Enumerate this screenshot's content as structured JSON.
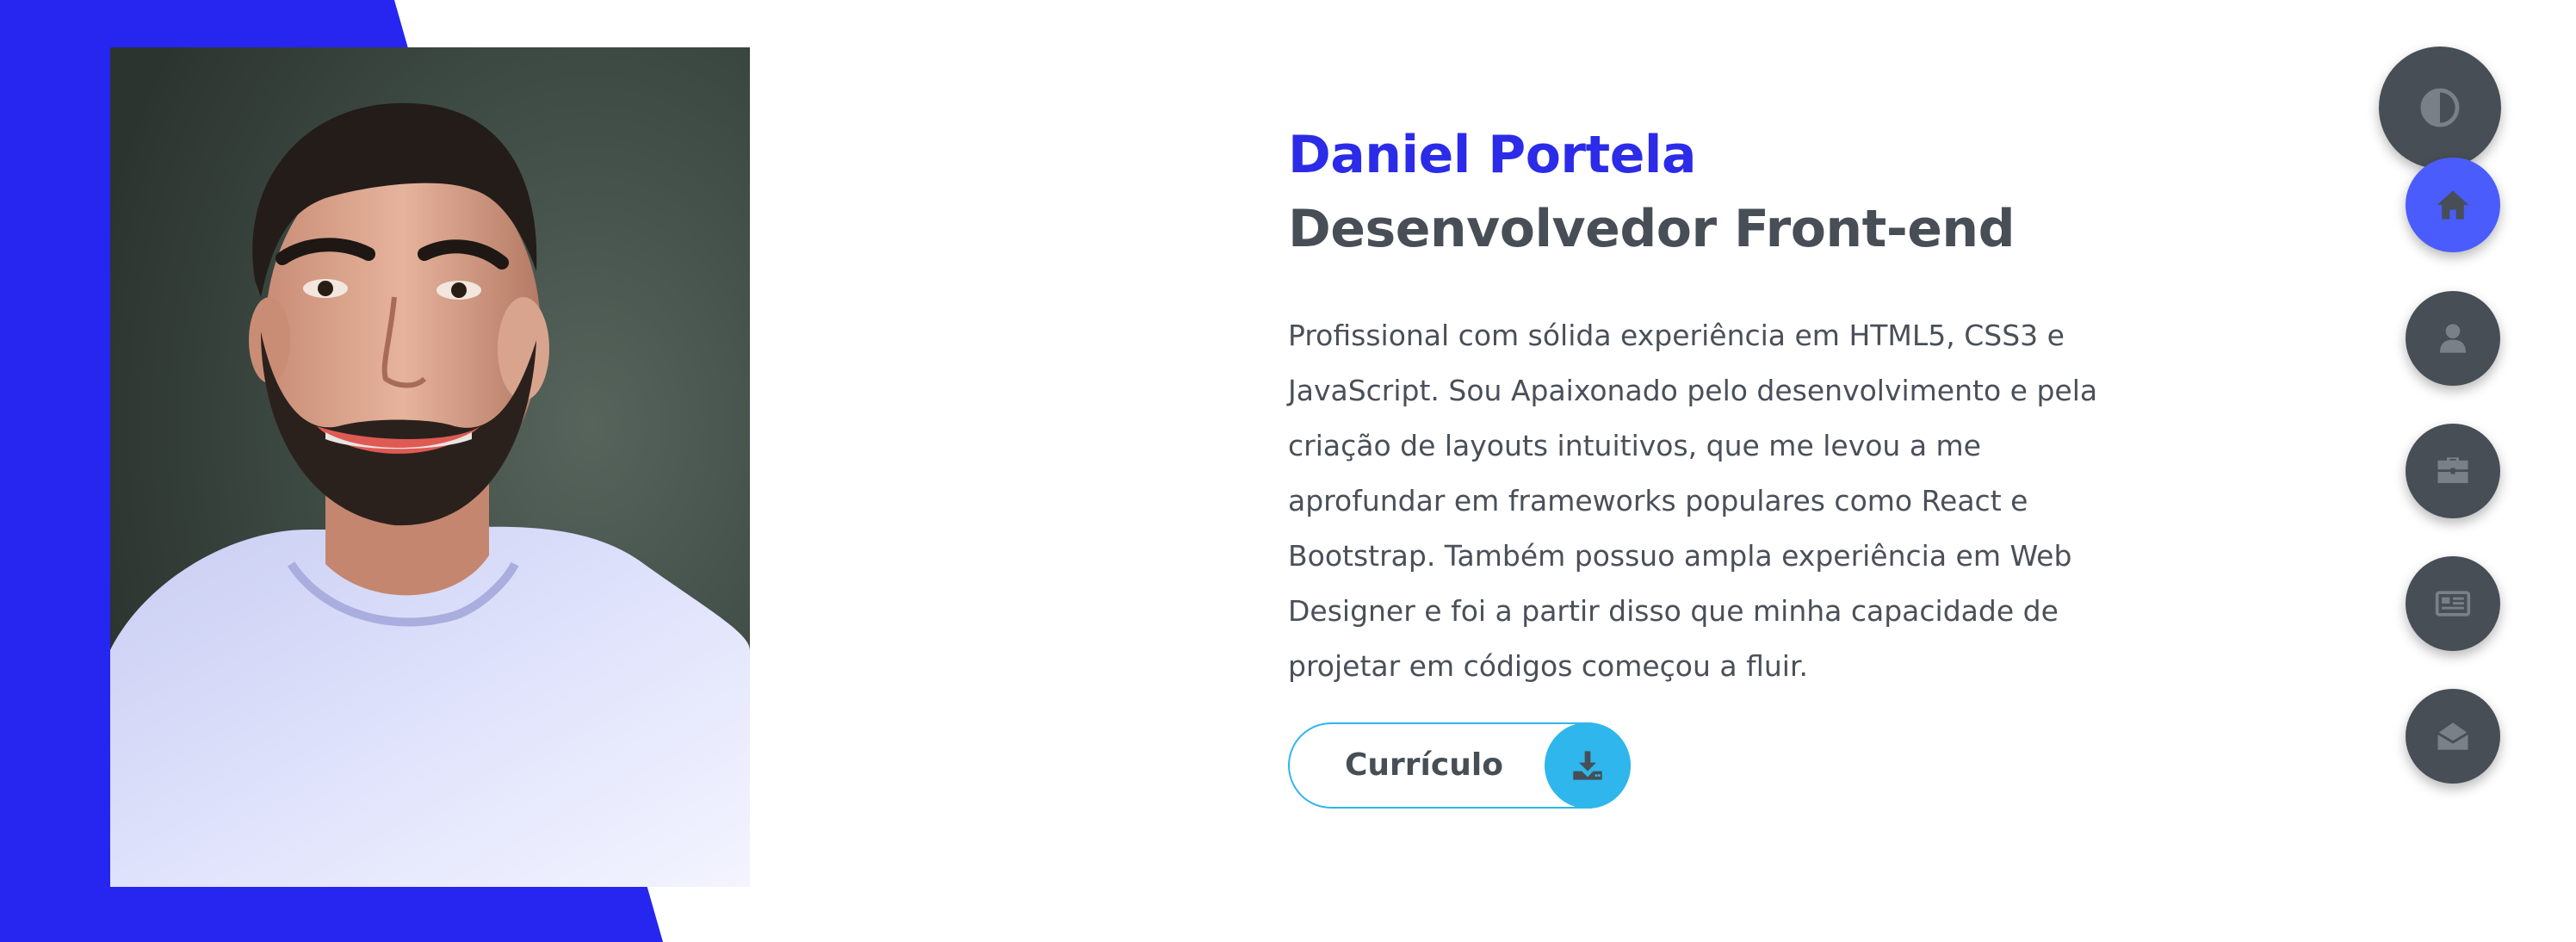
{
  "profile": {
    "name": "Daniel Portela",
    "role": "Desenvolvedor Front-end",
    "bio": "Profissional com sólida experiência em HTML5, CSS3 e JavaScript. Sou Apaixonado pelo desenvolvimento e pela criação de layouts intuitivos, que me levou a me aprofundar em frameworks populares como React e Bootstrap. Também possuo ampla experiência em Web Designer e foi a partir disso que minha capacidade de projetar em códigos começou a fluir."
  },
  "cv_button": {
    "label": "Currículo",
    "icon": "download-icon"
  },
  "theme_toggle": {
    "icon": "contrast-icon"
  },
  "nav": {
    "items": [
      {
        "icon": "home-icon",
        "active": true
      },
      {
        "icon": "user-icon",
        "active": false
      },
      {
        "icon": "briefcase-icon",
        "active": false
      },
      {
        "icon": "newspaper-icon",
        "active": false
      },
      {
        "icon": "envelope-open-icon",
        "active": false
      }
    ]
  },
  "colors": {
    "accent_blue": "#2b2be8",
    "text_dark": "#474e56",
    "button_cyan": "#2fb6ec",
    "nav_active": "#4a5cfb",
    "nav_default": "#474e56"
  }
}
